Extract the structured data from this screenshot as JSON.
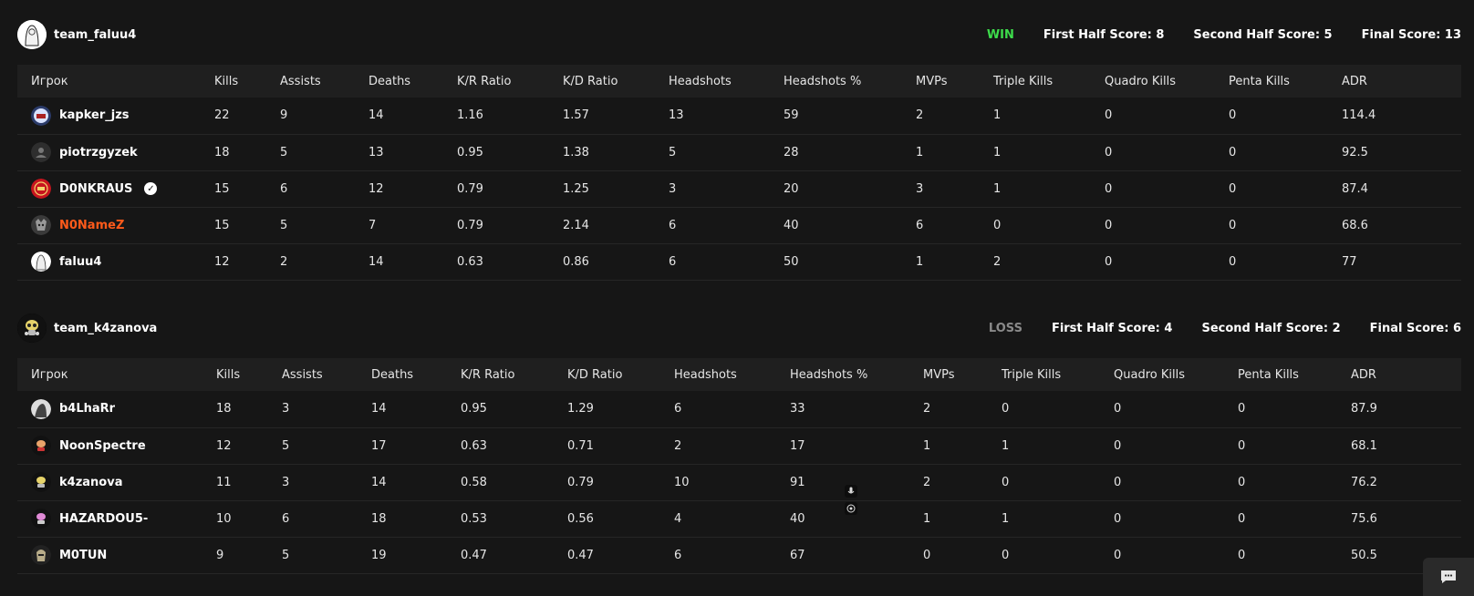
{
  "teams": [
    {
      "name": "team_faluu4",
      "result": "WIN",
      "first_half": "First Half Score: 8",
      "second_half": "Second Half Score: 5",
      "final": "Final Score: 13",
      "columns": [
        "Игрок",
        "Kills",
        "Assists",
        "Deaths",
        "K/R Ratio",
        "K/D Ratio",
        "Headshots",
        "Headshots %",
        "MVPs",
        "Triple Kills",
        "Quadro Kills",
        "Penta Kills",
        "ADR"
      ],
      "rows": [
        {
          "name": "kapker_jzs",
          "kills": "22",
          "assists": "9",
          "deaths": "14",
          "kr": "1.16",
          "kd": "1.57",
          "hs": "13",
          "hsp": "59",
          "mvps": "2",
          "triple": "1",
          "quadro": "0",
          "penta": "0",
          "adr": "114.4"
        },
        {
          "name": "piotrzgyzek",
          "kills": "18",
          "assists": "5",
          "deaths": "13",
          "kr": "0.95",
          "kd": "1.38",
          "hs": "5",
          "hsp": "28",
          "mvps": "1",
          "triple": "1",
          "quadro": "0",
          "penta": "0",
          "adr": "92.5"
        },
        {
          "name": "D0NKRAUS",
          "kills": "15",
          "assists": "6",
          "deaths": "12",
          "kr": "0.79",
          "kd": "1.25",
          "hs": "3",
          "hsp": "20",
          "mvps": "3",
          "triple": "1",
          "quadro": "0",
          "penta": "0",
          "adr": "87.4"
        },
        {
          "name": "N0NameZ",
          "kills": "15",
          "assists": "5",
          "deaths": "7",
          "kr": "0.79",
          "kd": "2.14",
          "hs": "6",
          "hsp": "40",
          "mvps": "6",
          "triple": "0",
          "quadro": "0",
          "penta": "0",
          "adr": "68.6"
        },
        {
          "name": "faluu4",
          "kills": "12",
          "assists": "2",
          "deaths": "14",
          "kr": "0.63",
          "kd": "0.86",
          "hs": "6",
          "hsp": "50",
          "mvps": "1",
          "triple": "2",
          "quadro": "0",
          "penta": "0",
          "adr": "77"
        }
      ]
    },
    {
      "name": "team_k4zanova",
      "result": "LOSS",
      "first_half": "First Half Score: 4",
      "second_half": "Second Half Score: 2",
      "final": "Final Score: 6",
      "columns": [
        "Игрок",
        "Kills",
        "Assists",
        "Deaths",
        "K/R Ratio",
        "K/D Ratio",
        "Headshots",
        "Headshots %",
        "MVPs",
        "Triple Kills",
        "Quadro Kills",
        "Penta Kills",
        "ADR"
      ],
      "rows": [
        {
          "name": "b4LhaRr",
          "kills": "18",
          "assists": "3",
          "deaths": "14",
          "kr": "0.95",
          "kd": "1.29",
          "hs": "6",
          "hsp": "33",
          "mvps": "2",
          "triple": "0",
          "quadro": "0",
          "penta": "0",
          "adr": "87.9"
        },
        {
          "name": "NoonSpectre",
          "kills": "12",
          "assists": "5",
          "deaths": "17",
          "kr": "0.63",
          "kd": "0.71",
          "hs": "2",
          "hsp": "17",
          "mvps": "1",
          "triple": "1",
          "quadro": "0",
          "penta": "0",
          "adr": "68.1"
        },
        {
          "name": "k4zanova",
          "kills": "11",
          "assists": "3",
          "deaths": "14",
          "kr": "0.58",
          "kd": "0.79",
          "hs": "10",
          "hsp": "91",
          "mvps": "2",
          "triple": "0",
          "quadro": "0",
          "penta": "0",
          "adr": "76.2"
        },
        {
          "name": "HAZARDOU5-",
          "kills": "10",
          "assists": "6",
          "deaths": "18",
          "kr": "0.53",
          "kd": "0.56",
          "hs": "4",
          "hsp": "40",
          "mvps": "1",
          "triple": "1",
          "quadro": "0",
          "penta": "0",
          "adr": "75.6"
        },
        {
          "name": "M0TUN",
          "kills": "9",
          "assists": "5",
          "deaths": "19",
          "kr": "0.47",
          "kd": "0.47",
          "hs": "6",
          "hsp": "67",
          "mvps": "0",
          "triple": "0",
          "quadro": "0",
          "penta": "0",
          "adr": "50.5"
        }
      ]
    }
  ],
  "colors": {
    "accent": "#ff5a1a",
    "win": "#3ddc4b",
    "loss": "#8a8a8a",
    "bg": "#161616"
  },
  "icons": {
    "chat": "chat-icon",
    "mic": "microphone-icon",
    "cursor": "target-icon",
    "verified": "verified-badge-icon"
  }
}
